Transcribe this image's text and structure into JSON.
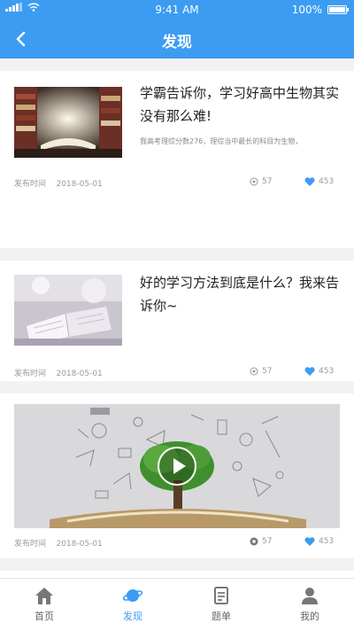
{
  "status_bar": {
    "time": "9:41 AM",
    "battery": "100%"
  },
  "nav": {
    "title": "发现"
  },
  "articles": [
    {
      "title": "学霸告诉你，学习好高中生物其实没有那么难!",
      "summary": "我高考理综分数276，理综当中最长的科目为生物，",
      "date_label": "发布时间",
      "date": "2018-05-01",
      "views": "57",
      "likes": "453"
    },
    {
      "title": "好的学习方法到底是什么？我来告诉你~",
      "date_label": "发布时间",
      "date": "2018-05-01",
      "views": "57",
      "likes": "453"
    },
    {
      "date_label": "发布时间",
      "date": "2018-05-01",
      "views": "57",
      "likes": "453"
    }
  ],
  "tabs": [
    {
      "label": "首页",
      "icon": "home-icon"
    },
    {
      "label": "发现",
      "icon": "planet-icon",
      "active": true
    },
    {
      "label": "题单",
      "icon": "quiz-list-icon"
    },
    {
      "label": "我的",
      "icon": "user-icon"
    }
  ],
  "colors": {
    "accent": "#3c9cf2",
    "like": "#3c9cf2",
    "background": "#f2f2f2"
  }
}
